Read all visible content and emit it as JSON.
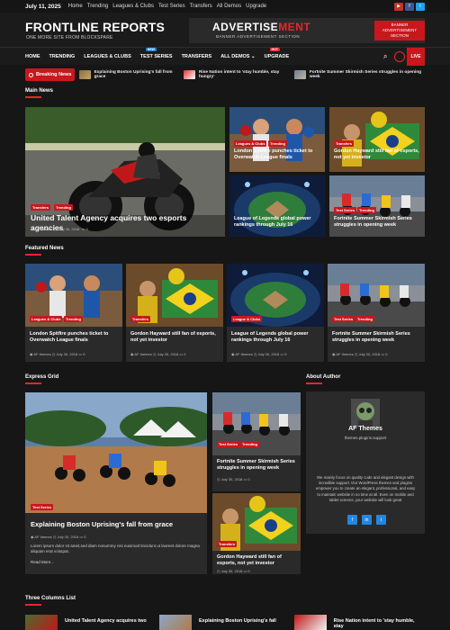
{
  "topbar": {
    "date": "July 11, 2025",
    "links": [
      "Home",
      "Trending",
      "Leagues & Clubs",
      "Test Series",
      "Transfers",
      "All Demos",
      "Upgrade"
    ]
  },
  "header": {
    "site_title": "FRONTLINE REPORTS",
    "tagline": "ONE MORE SITE FROM BLOCKSPARE",
    "ad_title_main": "ADVERTISE",
    "ad_title_accent": "MENT",
    "ad_sub": "BANNER ADVERTISEMENT SECTION",
    "ad_tag": "BANNER ADVERTISEMENT SECTION"
  },
  "nav": {
    "items": [
      "HOME",
      "TRENDING",
      "LEAGUES & CLUBS",
      "TEST SERIES",
      "TRANSFERS",
      "ALL DEMOS ⌄",
      "UPGRADE"
    ],
    "badge_new": "NEW",
    "badge_hot": "HOT",
    "live": "LIVE"
  },
  "ticker": {
    "label": "Breaking News",
    "items": [
      "Explaining Boston Uprising's fall from grace",
      "Rise Nation intent to 'stay humble, stay hungry'",
      "Fortnite Summer Skirmish Series struggles in opening week"
    ]
  },
  "main_news": {
    "title": "Main News",
    "hero": {
      "tags": [
        "Transfers",
        "Trending"
      ],
      "title": "United Talent Agency acquires two esports agencies",
      "author": "AF themes",
      "date": "July 30, 2018",
      "comments": "0"
    },
    "grid": [
      {
        "tags": [
          "Leagues & Clubs",
          "Trending"
        ],
        "title": "London Spitfire punches ticket to Overwatch League finals"
      },
      {
        "tags": [
          "Transfers"
        ],
        "title": "Gordon Hayward still fan of esports, not yet investor"
      },
      {
        "tags": [],
        "title": "League of Legends global power rankings through July 16"
      },
      {
        "tags": [
          "Test Series",
          "Trending"
        ],
        "title": "Fortnite Summer Skirmish Series struggles in opening week"
      }
    ]
  },
  "featured": {
    "title": "Featured News",
    "cards": [
      {
        "tags": [
          "Leagues & Clubs",
          "Trending"
        ],
        "title": "London Spitfire punches ticket to Overwatch League finals",
        "author": "AF themes",
        "date": "July 30, 2018",
        "comments": "0"
      },
      {
        "tags": [
          "Transfers"
        ],
        "title": "Gordon Hayward still fan of esports, not yet investor",
        "author": "AF themes",
        "date": "July 30, 2018",
        "comments": "0"
      },
      {
        "tags": [
          "League & Clubs"
        ],
        "title": "League of Legends global power rankings through July 16",
        "author": "AF themes",
        "date": "July 30, 2018",
        "comments": "0"
      },
      {
        "tags": [
          "Test Series",
          "Trending"
        ],
        "title": "Fortnite Summer Skirmish Series struggles in opening week",
        "author": "AF themes",
        "date": "July 30, 2018",
        "comments": "0"
      }
    ]
  },
  "express": {
    "title": "Express Grid",
    "big": {
      "tags": [
        "Test Series"
      ],
      "title": "Explaining Boston Uprising's fall from grace",
      "author": "AF themes",
      "date": "July 30, 2018",
      "comments": "0",
      "excerpt": "Lorem ipsum dolor sit amet,sed diam nonummy nisi euismod tincidunt ut laoreet dolore magna aliquam erat volutpat.",
      "read_more": "Read More..."
    },
    "side": [
      {
        "tags": [
          "Test Series",
          "Trending"
        ],
        "title": "Fortnite Summer Skirmish Series struggles in opening week",
        "date": "July 30, 2018",
        "comments": "0"
      },
      {
        "tags": [
          "Transfers"
        ],
        "title": "Gordon Hayward still fan of esports, not yet investor",
        "date": "July 30, 2018",
        "comments": "0"
      }
    ]
  },
  "author": {
    "section_title": "About Author",
    "name": "AF Themes",
    "subtitle": "themes.plugins.support",
    "bio": "We mainly focus on quality code and elegant design with incredible support. Our WordPress themes and plugins empower you to create an elegant, professional, and easy to maintain website in no time at all. Even on mobile and tablet screens, your website will look great"
  },
  "three_columns": {
    "title": "Three Columns List",
    "items": [
      "United Talent Agency acquires two",
      "Explaining Boston Uprising's fall",
      "Rise Nation intent to 'stay humble, stay"
    ]
  },
  "colors": {
    "accent": "#c8171d",
    "background": "#161616",
    "card": "#2a2a2a"
  }
}
